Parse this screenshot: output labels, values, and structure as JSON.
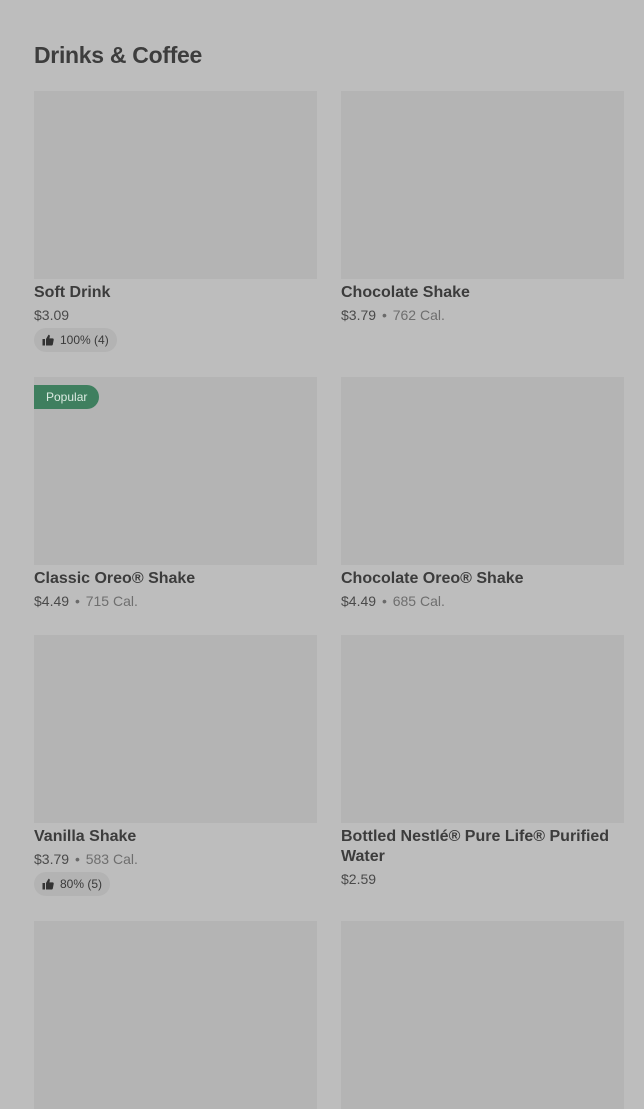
{
  "section": {
    "title": "Drinks & Coffee"
  },
  "items": [
    {
      "name": "Soft Drink",
      "price": "$3.09",
      "sep": "",
      "calories": "",
      "rating": "100% (4)",
      "badge": ""
    },
    {
      "name": "Chocolate Shake",
      "price": "$3.79",
      "sep": "•",
      "calories": "762 Cal.",
      "rating": "",
      "badge": ""
    },
    {
      "name": "Classic Oreo® Shake",
      "price": "$4.49",
      "sep": "•",
      "calories": "715 Cal.",
      "rating": "",
      "badge": "Popular"
    },
    {
      "name": "Chocolate Oreo® Shake",
      "price": "$4.49",
      "sep": "•",
      "calories": "685 Cal.",
      "rating": "",
      "badge": ""
    },
    {
      "name": "Vanilla Shake",
      "price": "$3.79",
      "sep": "•",
      "calories": "583 Cal.",
      "rating": "80% (5)",
      "badge": ""
    },
    {
      "name": "Bottled Nestlé® Pure Life® Purified Water",
      "price": "$2.59",
      "sep": "",
      "calories": "",
      "rating": "",
      "badge": ""
    }
  ],
  "icons": {
    "rating": "thumbs-up-icon"
  },
  "colors": {
    "badge_bg": "#3f7f5f",
    "image_placeholder": "#b4b4b4"
  }
}
